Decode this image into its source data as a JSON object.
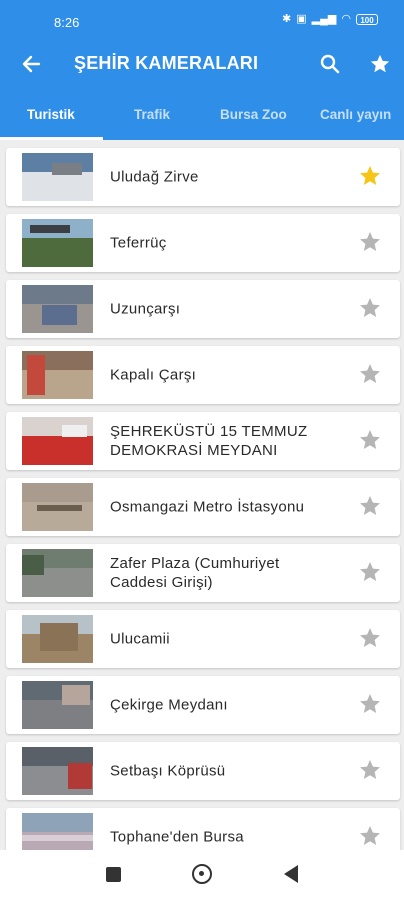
{
  "status_bar": {
    "time": "8:26",
    "battery": "100"
  },
  "app_bar": {
    "title": "ŞEHİR KAMERALARI",
    "back_icon": "arrow-left-icon",
    "search_icon": "search-icon",
    "favorite_icon": "star-icon"
  },
  "tabs": [
    {
      "label": "Turistik",
      "active": true
    },
    {
      "label": "Trafik",
      "active": false
    },
    {
      "label": "Bursa Zoo",
      "active": false
    },
    {
      "label": "Canlı yayın",
      "active": false
    }
  ],
  "cameras": [
    {
      "label": "Uludağ Zirve",
      "favorite": true
    },
    {
      "label": "Teferrüç",
      "favorite": false
    },
    {
      "label": "Uzunçarşı",
      "favorite": false
    },
    {
      "label": "Kapalı Çarşı",
      "favorite": false
    },
    {
      "label": "ŞEHREKÜSTÜ 15 TEMMUZ DEMOKRASİ MEYDANI",
      "favorite": false
    },
    {
      "label": "Osmangazi Metro İstasyonu",
      "favorite": false
    },
    {
      "label": "Zafer Plaza (Cumhuriyet Caddesi Girişi)",
      "favorite": false
    },
    {
      "label": "Ulucamii",
      "favorite": false
    },
    {
      "label": "Çekirge Meydanı",
      "favorite": false
    },
    {
      "label": "Setbaşı Köprüsü",
      "favorite": false
    },
    {
      "label": "Tophane'den Bursa",
      "favorite": false
    }
  ],
  "colors": {
    "primary": "#2f8ee8",
    "favorite_on": "#f5c518",
    "favorite_off": "#b5b5b5"
  }
}
